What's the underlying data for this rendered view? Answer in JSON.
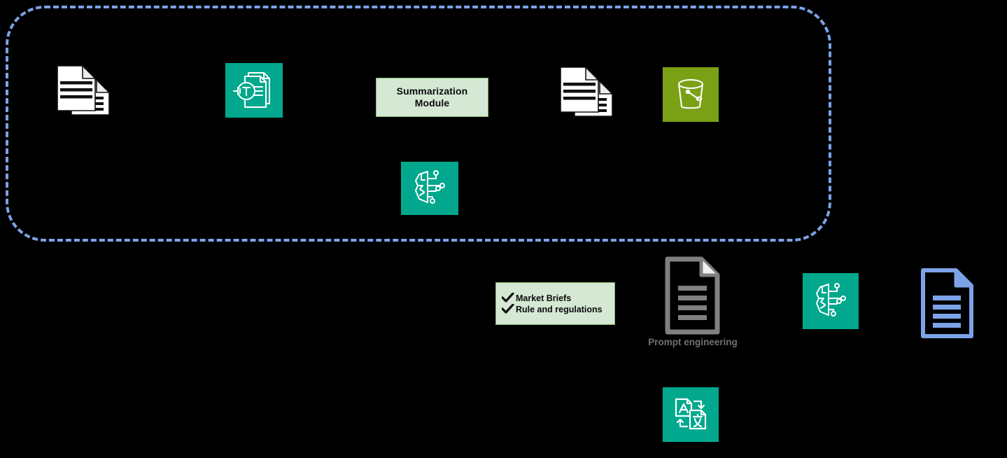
{
  "diagram": {
    "type": "architecture-flow-diagram",
    "background_color": "#000000",
    "boundary": {
      "name": "processing-boundary",
      "style": "dashed-rounded-rectangle",
      "color": "#7CA3E8"
    },
    "palette": {
      "teal": "#01A88D",
      "olive_green": "#7AA116",
      "light_green_fill": "#D5E8D4",
      "light_green_border": "#82B366",
      "blue_accent": "#7CA3E8",
      "gray_icon": "#707070",
      "white": "#FFFFFF"
    },
    "top_row": {
      "documents_stack_icon": {
        "label": "",
        "icon": "documents-stack-icon"
      },
      "text_extraction_icon": {
        "label": "",
        "icon": "document-text-extraction-icon",
        "tile_color": "#01A88D"
      },
      "summarization_module": {
        "label_line1": "Summarization",
        "label_line2": "Module"
      },
      "summary_documents_icon": {
        "label": "",
        "icon": "documents-stack-icon"
      },
      "storage_bucket_icon": {
        "label": "",
        "icon": "storage-bucket-icon",
        "tile_color": "#7AA116"
      },
      "ai_brain_icon": {
        "label": "",
        "icon": "ai-brain-circuit-icon",
        "tile_color": "#01A88D"
      }
    },
    "bottom_row": {
      "checklist_panel": {
        "items": [
          "Market Briefs",
          "Rule and regulations"
        ]
      },
      "prompt_document": {
        "caption": "Prompt engineering",
        "icon": "document-lines-icon"
      },
      "ai_brain_icon": {
        "label": "",
        "icon": "ai-brain-circuit-icon",
        "tile_color": "#01A88D"
      },
      "output_document_icon": {
        "label": "",
        "icon": "document-lines-icon",
        "color": "#7CA3E8"
      },
      "translate_icon": {
        "label": "",
        "icon": "language-translate-icon",
        "tile_color": "#01A88D"
      }
    }
  }
}
